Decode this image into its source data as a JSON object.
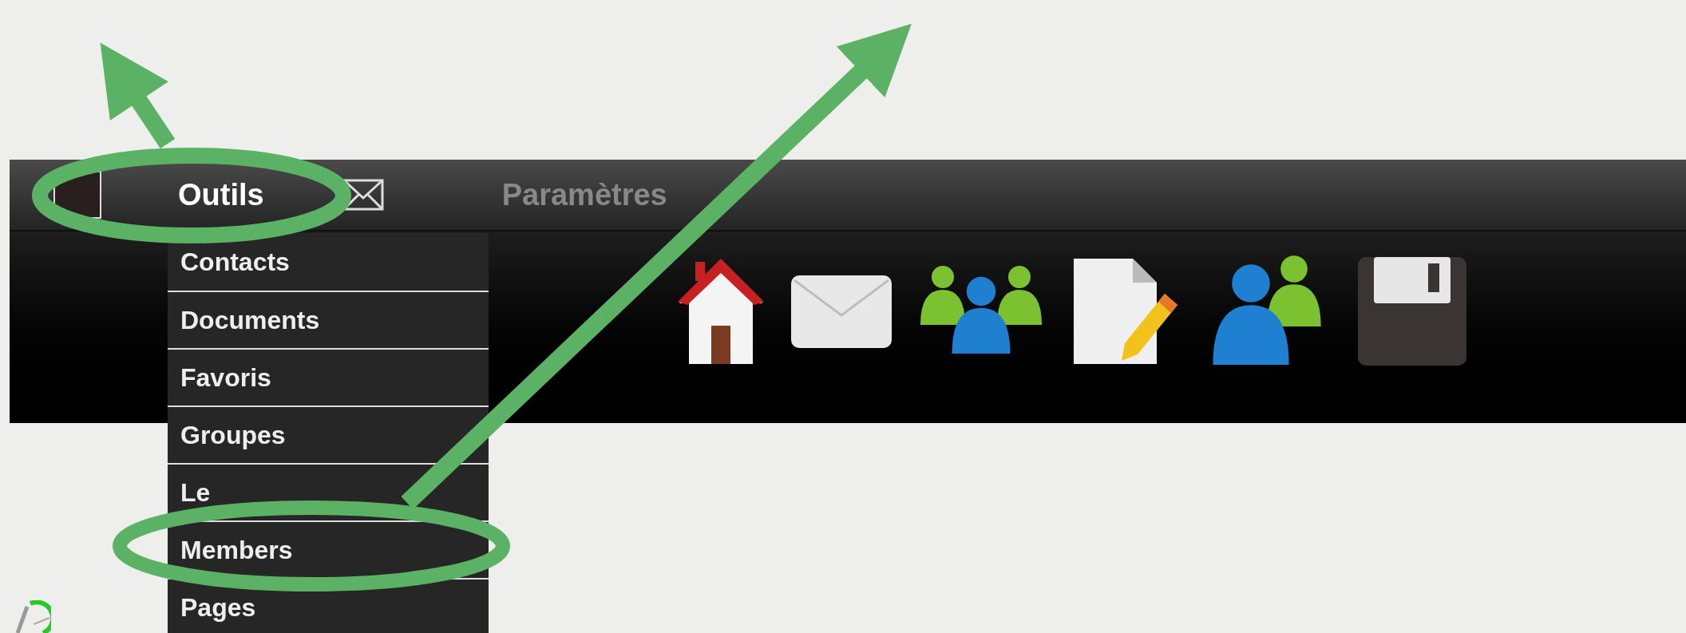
{
  "menu_bar": {
    "menus": [
      {
        "label": "Outils",
        "open": true
      },
      {
        "label": "Paramètres",
        "open": false
      }
    ]
  },
  "dropdown": {
    "items": [
      {
        "label": "Contacts"
      },
      {
        "label": "Documents"
      },
      {
        "label": "Favoris"
      },
      {
        "label": "Groupes"
      },
      {
        "label": "Le"
      },
      {
        "label": "Members"
      },
      {
        "label": "Pages"
      }
    ]
  }
}
